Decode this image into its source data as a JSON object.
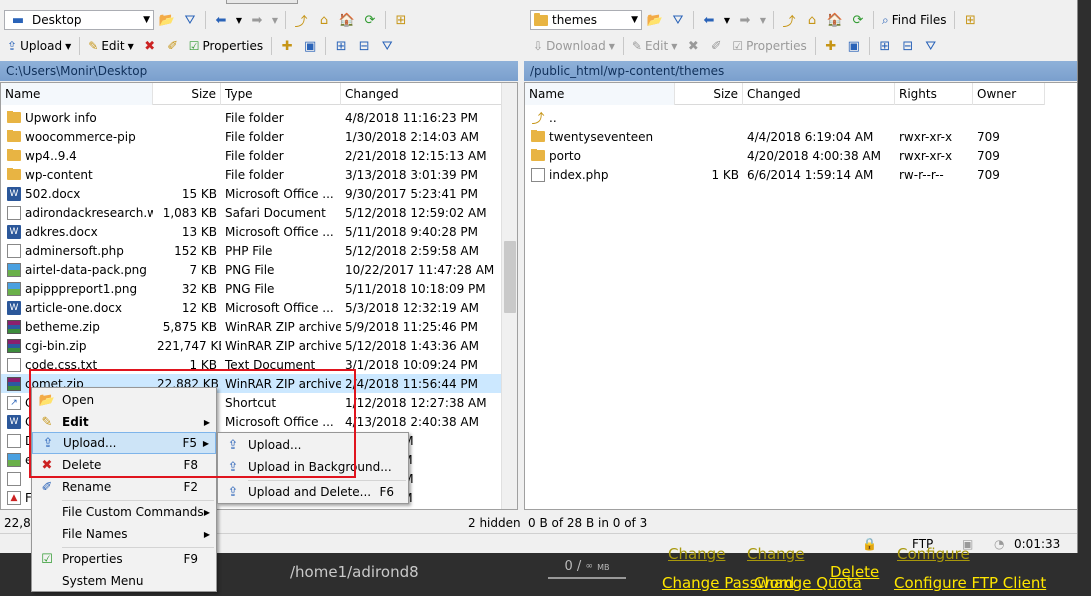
{
  "left": {
    "location": "Desktop",
    "toolbar": {
      "upload": "Upload",
      "edit": "Edit",
      "properties": "Properties"
    },
    "path": "C:\\Users\\Monir\\Desktop",
    "columns": [
      "Name",
      "Size",
      "Type",
      "Changed"
    ],
    "files": [
      {
        "name": "Upwork info",
        "size": "",
        "type": "File folder",
        "changed": "4/8/2018 11:16:23 PM",
        "icon": "folder"
      },
      {
        "name": "woocommerce-pip",
        "size": "",
        "type": "File folder",
        "changed": "1/30/2018 2:14:03 AM",
        "icon": "folder"
      },
      {
        "name": "wp4..9.4",
        "size": "",
        "type": "File folder",
        "changed": "2/21/2018 12:15:13 AM",
        "icon": "folder"
      },
      {
        "name": "wp-content",
        "size": "",
        "type": "File folder",
        "changed": "3/13/2018 3:01:39 PM",
        "icon": "folder"
      },
      {
        "name": "502.docx",
        "size": "15 KB",
        "type": "Microsoft Office ...",
        "changed": "9/30/2017 5:23:41 PM",
        "icon": "word"
      },
      {
        "name": "adirondackresearch.w...",
        "size": "1,083 KB",
        "type": "Safari Document",
        "changed": "5/12/2018 12:59:02 AM",
        "icon": "doc"
      },
      {
        "name": "adkres.docx",
        "size": "13 KB",
        "type": "Microsoft Office ...",
        "changed": "5/11/2018 9:40:28 PM",
        "icon": "word"
      },
      {
        "name": "adminersoft.php",
        "size": "152 KB",
        "type": "PHP File",
        "changed": "5/12/2018 2:59:58 AM",
        "icon": "doc"
      },
      {
        "name": "airtel-data-pack.png",
        "size": "7 KB",
        "type": "PNG File",
        "changed": "10/22/2017 11:47:28 AM",
        "icon": "img"
      },
      {
        "name": "apipppreport1.png",
        "size": "32 KB",
        "type": "PNG File",
        "changed": "5/11/2018 10:18:09 PM",
        "icon": "img"
      },
      {
        "name": "article-one.docx",
        "size": "12 KB",
        "type": "Microsoft Office ...",
        "changed": "5/3/2018 12:32:19 AM",
        "icon": "word"
      },
      {
        "name": "betheme.zip",
        "size": "5,875 KB",
        "type": "WinRAR ZIP archive",
        "changed": "5/9/2018 11:25:46 PM",
        "icon": "zip"
      },
      {
        "name": "cgi-bin.zip",
        "size": "221,747 KB",
        "type": "WinRAR ZIP archive",
        "changed": "5/12/2018 1:43:36 AM",
        "icon": "zip"
      },
      {
        "name": "code.css.txt",
        "size": "1 KB",
        "type": "Text Document",
        "changed": "3/1/2018 10:09:24 PM",
        "icon": "doc"
      },
      {
        "name": "comet.zip",
        "size": "22,882 KB",
        "type": "WinRAR ZIP archive",
        "changed": "2/4/2018 11:56:44 PM",
        "icon": "zip"
      },
      {
        "name": "C",
        "size": "",
        "type": "Shortcut",
        "changed": "1/12/2018 12:27:38 AM",
        "icon": "link"
      },
      {
        "name": "C",
        "size": "",
        "type": "Microsoft Office ...",
        "changed": "4/13/2018 2:40:38 AM",
        "icon": "word"
      },
      {
        "name": "D",
        "size": "",
        "type": "",
        "changed": "8:26:03 AM",
        "icon": "doc"
      },
      {
        "name": "e",
        "size": "",
        "type": "",
        "changed": "6:18:41 PM",
        "icon": "img"
      },
      {
        "name": "",
        "size": "",
        "type": "",
        "changed": "0:01:12 AM",
        "icon": "doc"
      },
      {
        "name": "F",
        "size": "",
        "type": "",
        "changed": "0:59:31 PM",
        "icon": "pdf"
      }
    ],
    "status": "22,88"
  },
  "right": {
    "location": "themes",
    "toolbar": {
      "download": "Download",
      "edit": "Edit",
      "properties": "Properties",
      "find": "Find Files"
    },
    "path": "/public_html/wp-content/themes",
    "columns": [
      "Name",
      "Size",
      "Changed",
      "Rights",
      "Owner"
    ],
    "files": [
      {
        "name": "..",
        "size": "",
        "changed": "",
        "rights": "",
        "owner": "",
        "icon": "up"
      },
      {
        "name": "twentyseventeen",
        "size": "",
        "changed": "4/4/2018 6:19:04 AM",
        "rights": "rwxr-xr-x",
        "owner": "709",
        "icon": "folder"
      },
      {
        "name": "porto",
        "size": "",
        "changed": "4/20/2018 4:00:38 AM",
        "rights": "rwxr-xr-x",
        "owner": "709",
        "icon": "folder"
      },
      {
        "name": "index.php",
        "size": "1 KB",
        "changed": "6/6/2014 1:59:14 AM",
        "rights": "rw-r--r--",
        "owner": "709",
        "icon": "doc"
      }
    ],
    "status": {
      "hidden": "2 hidden",
      "selection": "0 B of 28 B in 0 of 3"
    }
  },
  "statusbar": {
    "protocol": "FTP",
    "timer": "0:01:33"
  },
  "context_menu": [
    {
      "label": "Open",
      "shortcut": "",
      "icon": "folder-open-icon"
    },
    {
      "label": "Edit",
      "shortcut": "",
      "icon": "edit-icon",
      "submenu": true,
      "bold": true
    },
    {
      "label": "Upload...",
      "shortcut": "F5",
      "icon": "upload-icon",
      "submenu": true,
      "highlighted": true
    },
    {
      "label": "Delete",
      "shortcut": "F8",
      "icon": "delete-icon"
    },
    {
      "label": "Rename",
      "shortcut": "F2",
      "icon": "rename-icon"
    },
    {
      "label": "File Custom Commands",
      "shortcut": "",
      "icon": "",
      "submenu": true
    },
    {
      "label": "File Names",
      "shortcut": "",
      "icon": "",
      "submenu": true
    },
    {
      "label": "Properties",
      "shortcut": "F9",
      "icon": "properties-icon"
    },
    {
      "label": "System Menu",
      "shortcut": "",
      "icon": ""
    }
  ],
  "upload_submenu": [
    {
      "label": "Upload...",
      "shortcut": ""
    },
    {
      "label": "Upload in Background...",
      "shortcut": ""
    },
    {
      "label": "Upload and Delete...",
      "shortcut": "F6"
    }
  ],
  "background_page": {
    "path": "/home1/adirond8",
    "gauge_top": "0 /",
    "gauge_unit": "MB",
    "links": [
      "Change Password",
      "Change Quota",
      "Delete",
      "Configure FTP Client"
    ],
    "ghost_links": [
      "Change",
      "Change",
      "Configure"
    ]
  },
  "colors": {
    "highlight_box": "#e0141e",
    "path_bar": "#7a9fcd",
    "link": "#ffe600"
  }
}
